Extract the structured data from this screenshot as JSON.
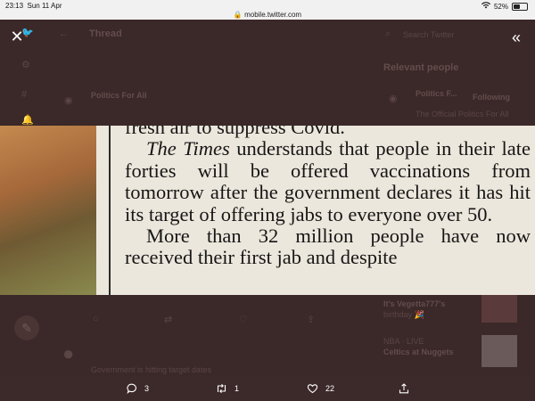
{
  "status_bar": {
    "time": "23:13",
    "date": "Sun 11 Apr",
    "url": "mobile.twitter.com",
    "battery": "52%",
    "battery_level": 0.52
  },
  "backdrop": {
    "header_title": "Thread",
    "search_placeholder": "Search Twitter",
    "relevant_people_title": "Relevant people",
    "account_name": "Politics For All",
    "account_name_short": "Politics F...",
    "following_label": "Following",
    "account_bio": "The Official Politics For All",
    "trend_1": "It's Vegetta777's",
    "trend_1b": "birthday 🎉",
    "trend_2_tag": "NBA · LIVE",
    "trend_2": "Celtics at Nuggets",
    "reply_text": "Government is hitting target dates"
  },
  "clipping": {
    "line_top": "fresh air to suppress Covid.",
    "para1_italic": "The Times",
    "para1_rest": " understands that people in their late forties will be offered vaccinations from tomorrow after the government declares it has hit its target of offering jabs to everyone over 50.",
    "para2": "More than 32 million people have now received their first jab and despite"
  },
  "actions": {
    "reply_count": "3",
    "retweet_count": "1",
    "like_count": "22"
  },
  "colors": {
    "overlay": "#3b2828",
    "paper": "#ece7dc",
    "ink": "#161616"
  }
}
